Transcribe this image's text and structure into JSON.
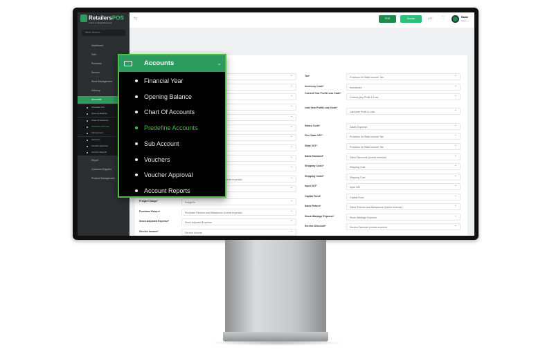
{
  "brand": {
    "name": "Retailers",
    "name_accent": "POS",
    "tagline": "Future of Retail Business"
  },
  "sidebar": {
    "search_placeholder": "Menu Search...",
    "items": [
      {
        "label": "Dashboard"
      },
      {
        "label": "Sale"
      },
      {
        "label": "Purchase"
      },
      {
        "label": "Service"
      },
      {
        "label": "Stock Management"
      },
      {
        "label": "Delivery"
      },
      {
        "label": "Accounts",
        "active": true
      }
    ],
    "sub_items": [
      "Financial Year",
      "Opening Balance",
      "Chart Of Accounts",
      "Predefine Accounts",
      "Sub Account",
      "Vouchers",
      "Voucher Approval",
      "Account Reports"
    ],
    "items_after": [
      {
        "label": "Report"
      },
      {
        "label": "Customer/Supplier"
      },
      {
        "label": "Product Management"
      }
    ]
  },
  "topbar": {
    "pos_label": "POS",
    "service_label": "Service",
    "lang": "UTF",
    "user_name": "Rabbi",
    "user_role": "Admin"
  },
  "colors": {
    "accent": "#2e9b5e",
    "highlight": "#3cc23c",
    "sidebar": "#2b2f31"
  },
  "popup": {
    "title": "Accounts",
    "items": [
      "Financial Year",
      "Opening Balance",
      "Chart Of Accounts",
      "Predefine Accounts",
      "Sub Account",
      "Vouchers",
      "Voucher Approval",
      "Account Reports"
    ],
    "selected": "Predefine Accounts"
  },
  "form": {
    "left": [
      {
        "label": "",
        "value": "Purchase Returns and Allowances (contra expense)"
      },
      {
        "label": "",
        "value": ""
      },
      {
        "label": "Freight Charge*",
        "value": "Freight In"
      },
      {
        "label": "Purchase Return*",
        "value": "Purchase Returns and Allowances (contra expense)"
      },
      {
        "label": "Stock Adjusted Expense*",
        "value": "Stock Adjusted Expense"
      },
      {
        "label": "Service Income*",
        "value": "Service Income"
      }
    ],
    "right": [
      {
        "label": "Tax*",
        "value": "Provision for State Income Tax"
      },
      {
        "label": "Inventory Code*",
        "value": "Inventories"
      },
      {
        "label": "Current Year Profit Loss Code*",
        "value": "Current year Profit & Loss"
      },
      {
        "label": "Last Year Profit Loss Code*",
        "value": "Last year Profit & Loss"
      },
      {
        "label": "Salary Code*",
        "value": "Salary Expense"
      },
      {
        "label": "Five State VAT*",
        "value": "Provision for State Income Tax"
      },
      {
        "label": "State VAT*",
        "value": "Provision for State Income Tax"
      },
      {
        "label": "Sales Discount*",
        "value": "Sales Discounts (contra revenue)"
      },
      {
        "label": "Shipping Cost1*",
        "value": "Shipping Cost"
      },
      {
        "label": "Shipping Cost2*",
        "value": "Shipping Cost"
      },
      {
        "label": "Input VAT*",
        "value": "Input VAT"
      },
      {
        "label": "Capital Fund*",
        "value": "Capital Fund"
      },
      {
        "label": "Sales Return*",
        "value": "Sales Returns and Allowances (contra revenue)"
      },
      {
        "label": "Stock Wastage Expense*",
        "value": "Stock Wastage Expense"
      },
      {
        "label": "Service Discount*",
        "value": "Service Discount (contra revenue)"
      }
    ]
  }
}
